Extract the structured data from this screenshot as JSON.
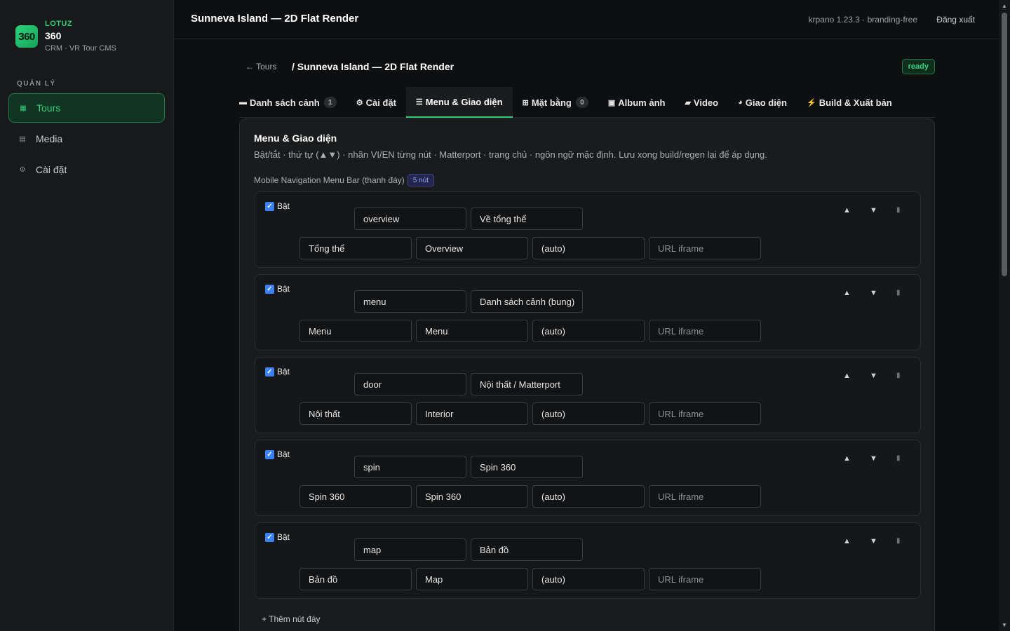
{
  "brand": {
    "logo_text": "360",
    "top": "LOTUZ",
    "name": "360",
    "sub": "CRM · VR Tour CMS"
  },
  "sidebar": {
    "section": "QUẢN LÝ",
    "items": [
      {
        "label": "Tours",
        "icon": "grid-icon",
        "glyph": "▦"
      },
      {
        "label": "Media",
        "icon": "list-icon",
        "glyph": "▤"
      },
      {
        "label": "Cài đặt",
        "icon": "gear-icon",
        "glyph": "⚙"
      }
    ]
  },
  "topbar": {
    "title": "Sunneva Island — 2D Flat Render",
    "version": "krpano 1.23.3 · branding-free",
    "logout": "Đăng xuất"
  },
  "breadcrumb": {
    "back": "← Tours",
    "title": "/ Sunneva Island — 2D Flat Render",
    "status": "ready"
  },
  "tabs": [
    {
      "label": "Danh sách cảnh",
      "glyph": "▬",
      "icon": "scenes-icon",
      "count": "1"
    },
    {
      "label": "Cài đặt",
      "glyph": "⚙",
      "icon": "gear-icon"
    },
    {
      "label": "Menu & Giao diện",
      "glyph": "☰",
      "icon": "menu-icon"
    },
    {
      "label": "Mặt bằng",
      "glyph": "⊞",
      "icon": "floorplan-icon",
      "count": "0"
    },
    {
      "label": "Album ảnh",
      "glyph": "▣",
      "icon": "album-icon"
    },
    {
      "label": "Video",
      "glyph": "▰",
      "icon": "video-icon"
    },
    {
      "label": "Giao diện",
      "glyph": "◕",
      "icon": "palette-icon"
    },
    {
      "label": "Build & Xuất bản",
      "glyph": "⚡",
      "icon": "bolt-icon"
    }
  ],
  "panel": {
    "title": "Menu & Giao diện",
    "description": "Bật/tắt · thứ tự (▲▼) · nhãn VI/EN từng nút · Matterport · trang chủ · ngôn ngữ mặc định. Lưu xong build/regen lại để áp dụng.",
    "section_label": "Mobile Navigation Menu Bar (thanh đáy)",
    "section_badge": "5 nút",
    "add_button": "+ Thêm nút đáy"
  },
  "menu_items": [
    {
      "enabled_label": "Bật",
      "id": "overview",
      "label": "Về tổng thể",
      "vi": "Tổng thể",
      "en": "Overview",
      "target": "(auto)",
      "url_placeholder": "URL iframe"
    },
    {
      "enabled_label": "Bật",
      "id": "menu",
      "label": "Danh sách cảnh (bung)",
      "vi": "Menu",
      "en": "Menu",
      "target": "(auto)",
      "url_placeholder": "URL iframe"
    },
    {
      "enabled_label": "Bật",
      "id": "door",
      "label": "Nội thất / Matterport",
      "vi": "Nội thất",
      "en": "Interior",
      "target": "(auto)",
      "url_placeholder": "URL iframe"
    },
    {
      "enabled_label": "Bật",
      "id": "spin",
      "label": "Spin 360",
      "vi": "Spin 360",
      "en": "Spin 360",
      "target": "(auto)",
      "url_placeholder": "URL iframe"
    },
    {
      "enabled_label": "Bật",
      "id": "map",
      "label": "Bản đồ",
      "vi": "Bản đồ",
      "en": "Map",
      "target": "(auto)",
      "url_placeholder": "URL iframe"
    }
  ],
  "controls": {
    "up": "▲",
    "down": "▼",
    "delete": "▮",
    "check": "✓"
  },
  "colors": {
    "accent": "#2ed17a",
    "checkbox": "#3b82f6",
    "badge": "#9aa4ff"
  }
}
